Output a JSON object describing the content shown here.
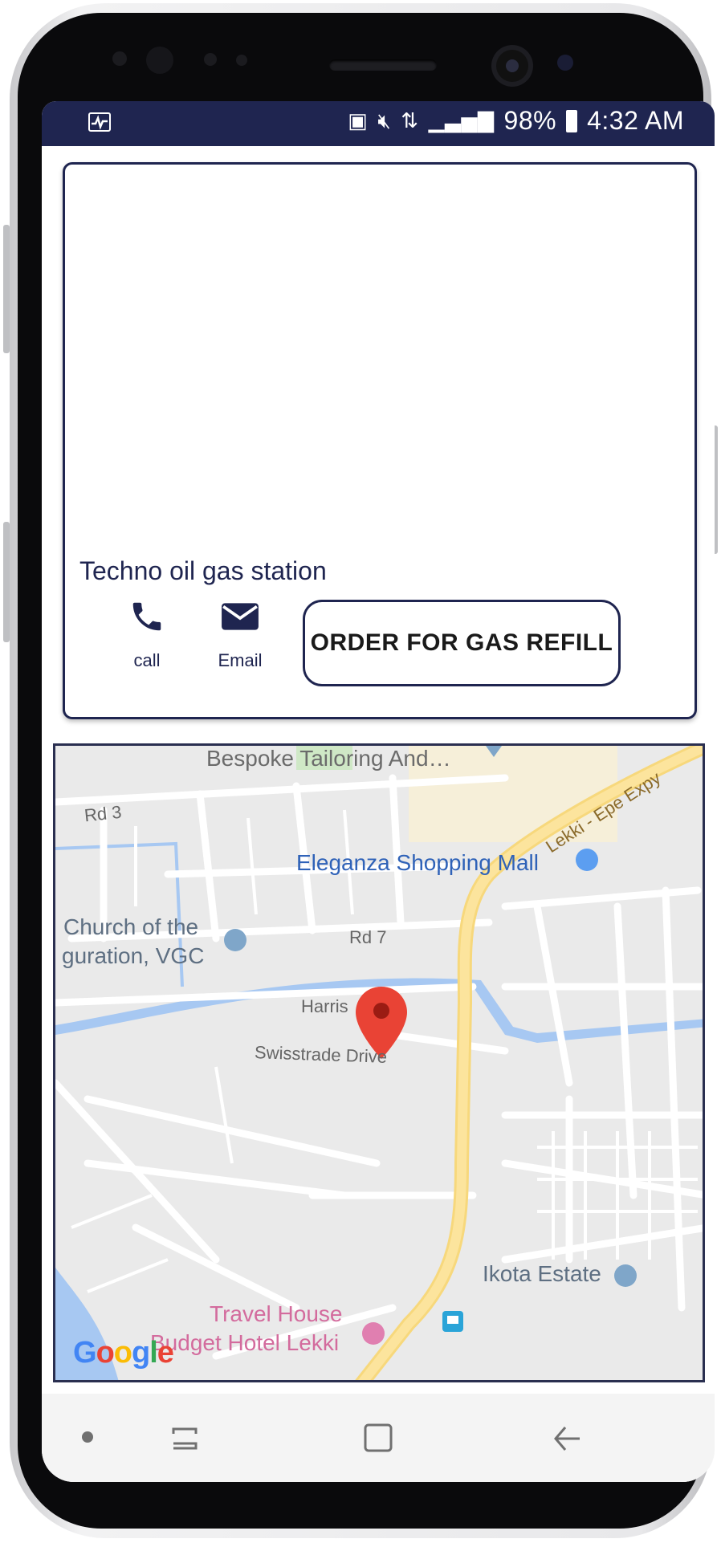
{
  "status_bar": {
    "battery": "98%",
    "time": "4:32 AM"
  },
  "station": {
    "name": "Techno oil gas station",
    "call_label": "call",
    "email_label": "Email",
    "order_button": "ORDER FOR GAS REFILL"
  },
  "map": {
    "labels": {
      "bespoke": "Bespoke Tailoring And…",
      "rd3": "Rd 3",
      "lekki": "Lekki - Epe Expy",
      "eleganza": "Eleganza Shopping Mall",
      "church1": "Church of the",
      "church2": "guration, VGC",
      "rd7": "Rd 7",
      "harris": "Harris",
      "swisstrade": "Swisstrade Drive",
      "ikota": "Ikota Estate",
      "travel1": "Travel House",
      "travel2": "Budget Hotel Lekki",
      "google": "Google"
    }
  },
  "colors": {
    "brand_navy": "#1f2550",
    "road_yellow": "#fce49d",
    "water_blue": "#a7c8f2",
    "pin_red": "#e94335"
  }
}
